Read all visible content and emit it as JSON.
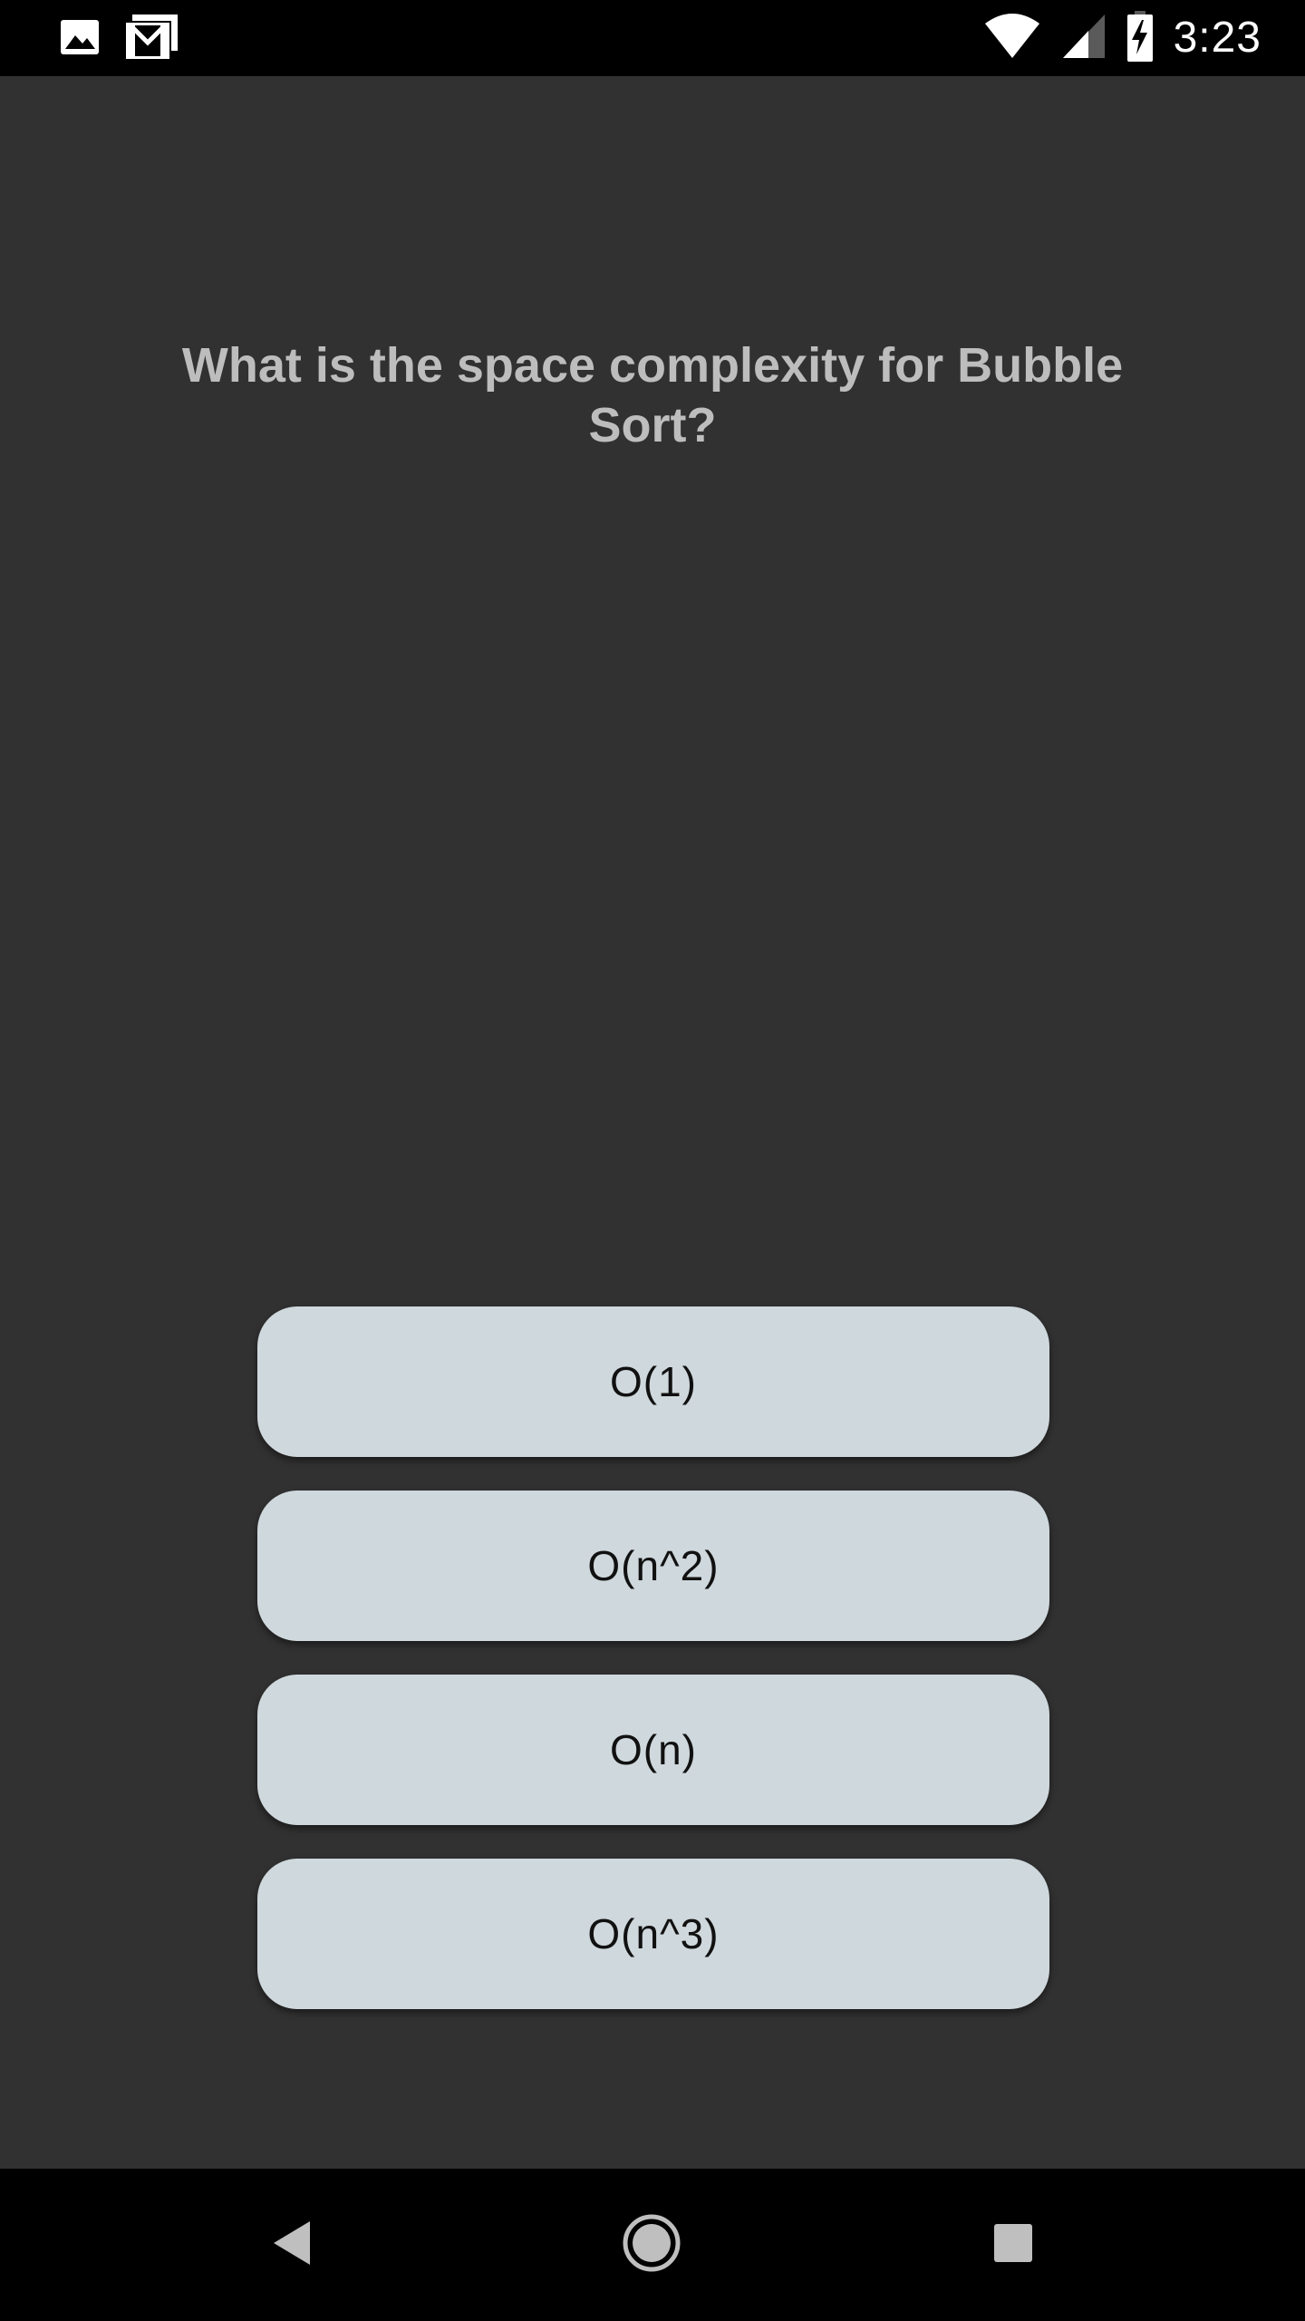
{
  "status_bar": {
    "time": "3:23",
    "icons": [
      "image-notification-icon",
      "gmail-notification-icon",
      "wifi-icon",
      "signal-icon",
      "battery-charging-icon"
    ]
  },
  "quiz": {
    "question": "What is the space complexity for Bubble Sort?",
    "answers": [
      "O(1)",
      "O(n^2)",
      "O(n)",
      "O(n^3)"
    ]
  },
  "nav_bar": {
    "icons": [
      "back-icon",
      "home-icon",
      "recents-icon"
    ]
  },
  "colors": {
    "background": "#313131",
    "button": "#cfd8dc",
    "question_text": "#bdbdbd"
  }
}
